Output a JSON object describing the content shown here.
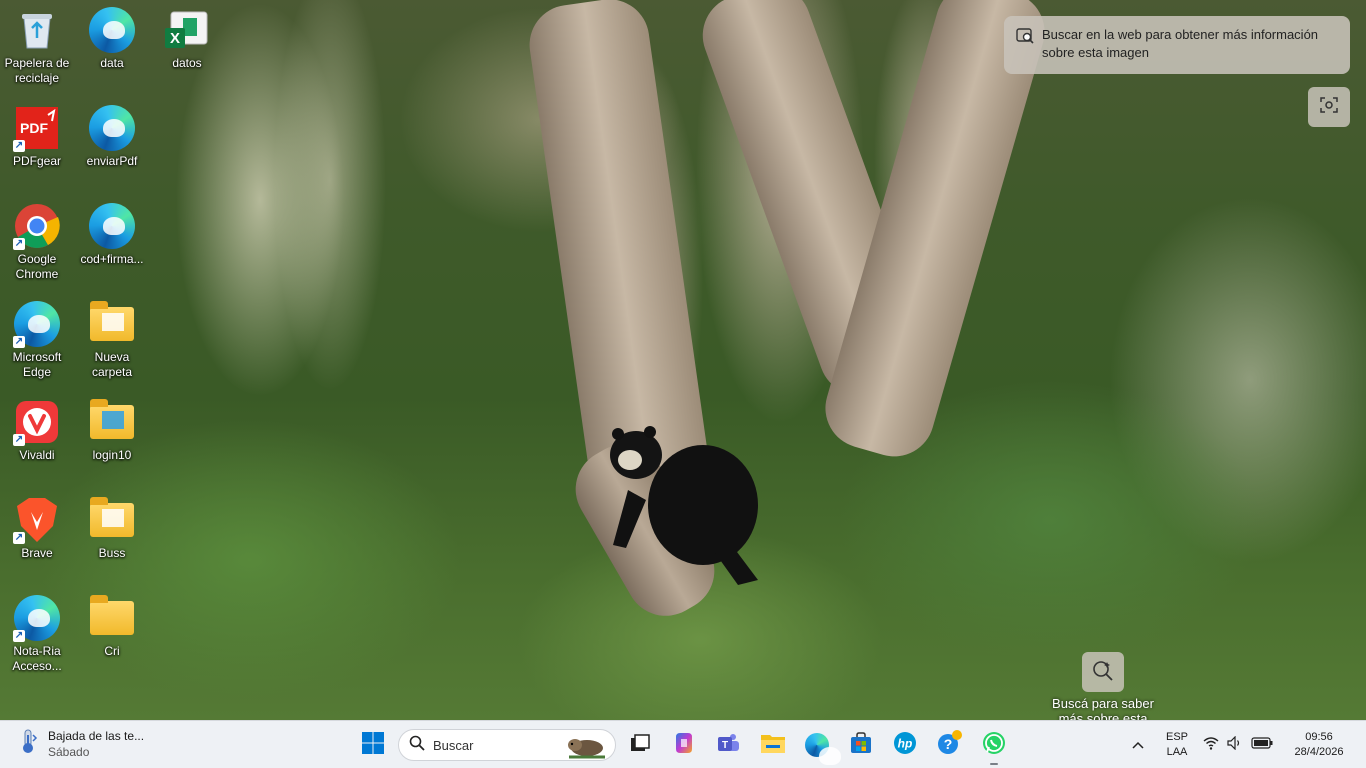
{
  "desktop": {
    "icons": [
      {
        "label": "Papelera de reciclaje",
        "icon": "recycle-bin-icon"
      },
      {
        "label": "data",
        "icon": "edge-icon"
      },
      {
        "label": "datos",
        "icon": "excel-icon"
      },
      {
        "label": "PDFgear",
        "icon": "pdf-icon"
      },
      {
        "label": "enviarPdf",
        "icon": "edge-icon"
      },
      {
        "label": "Google Chrome",
        "icon": "chrome-icon"
      },
      {
        "label": "cod+firma...",
        "icon": "edge-icon"
      },
      {
        "label": "Microsoft Edge",
        "icon": "edge-icon"
      },
      {
        "label": "Nueva carpeta",
        "icon": "folder-icon"
      },
      {
        "label": "Vivaldi",
        "icon": "vivaldi-icon"
      },
      {
        "label": "login10",
        "icon": "folder-icon"
      },
      {
        "label": "Brave",
        "icon": "brave-icon"
      },
      {
        "label": "Buss",
        "icon": "folder-icon"
      },
      {
        "label": "Nota-Ria Acceso...",
        "icon": "edge-icon"
      },
      {
        "label": "Cri",
        "icon": "folder-icon"
      }
    ]
  },
  "bing": {
    "visual_search_text": "Buscar en la web para obtener más información sobre esta imagen",
    "spotlight_label": "Buscá para saber más sobre esta"
  },
  "taskbar": {
    "weather_title": "Bajada de las te...",
    "weather_sub": "Sábado",
    "search_placeholder": "Buscar",
    "lang_top": "ESP",
    "lang_bottom": "LAA",
    "time": "09:56",
    "date": "28/4/2026",
    "pinned": [
      "start-icon",
      "task-view-icon",
      "copilot-icon",
      "teams-icon",
      "file-explorer-icon",
      "edge-icon",
      "store-icon",
      "hp-icon",
      "help-icon",
      "whatsapp-icon"
    ]
  },
  "colors": {
    "taskbar_bg": "#eef1f5",
    "accent": "#0067c0"
  }
}
